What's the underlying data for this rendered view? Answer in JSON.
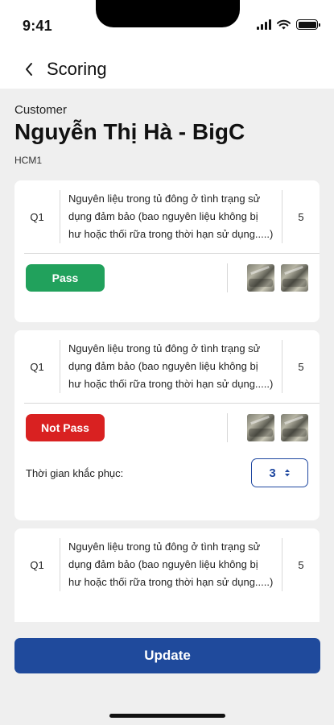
{
  "status_bar": {
    "time": "9:41"
  },
  "nav": {
    "title": "Scoring"
  },
  "customer": {
    "label": "Customer",
    "name": "Nguyễn Thị Hà - BigC",
    "code": "HCM1"
  },
  "questions": [
    {
      "number": "Q1",
      "text": "Nguyên liệu trong tủ đông ở tình trạng sử dụng đảm bảo (bao nguyên liệu không bị hư hoặc thối rữa trong thời hạn sử dụng.....)",
      "score": "5",
      "status": "Pass"
    },
    {
      "number": "Q1",
      "text": "Nguyên liệu trong tủ đông ở tình trạng sử dụng đảm bảo (bao nguyên liệu không bị hư hoặc thối rữa trong thời hạn sử dụng.....)",
      "score": "5",
      "status": "Not Pass",
      "fix_label": "Thời gian khắc phục:",
      "fix_value": "3"
    },
    {
      "number": "Q1",
      "text": "Nguyên liệu trong tủ đông ở tình trạng sử dụng đảm bảo (bao nguyên liệu không bị hư hoặc thối rữa trong thời hạn sử dụng.....)",
      "score": "5"
    }
  ],
  "actions": {
    "update_label": "Update"
  },
  "colors": {
    "pass": "#21a15c",
    "fail": "#d92121",
    "primary": "#1f4a9c"
  },
  "icons": {
    "back": "chevron-left-icon",
    "stepper": "up-down-arrows-icon",
    "thumbnail": "photo-thumbnail"
  }
}
